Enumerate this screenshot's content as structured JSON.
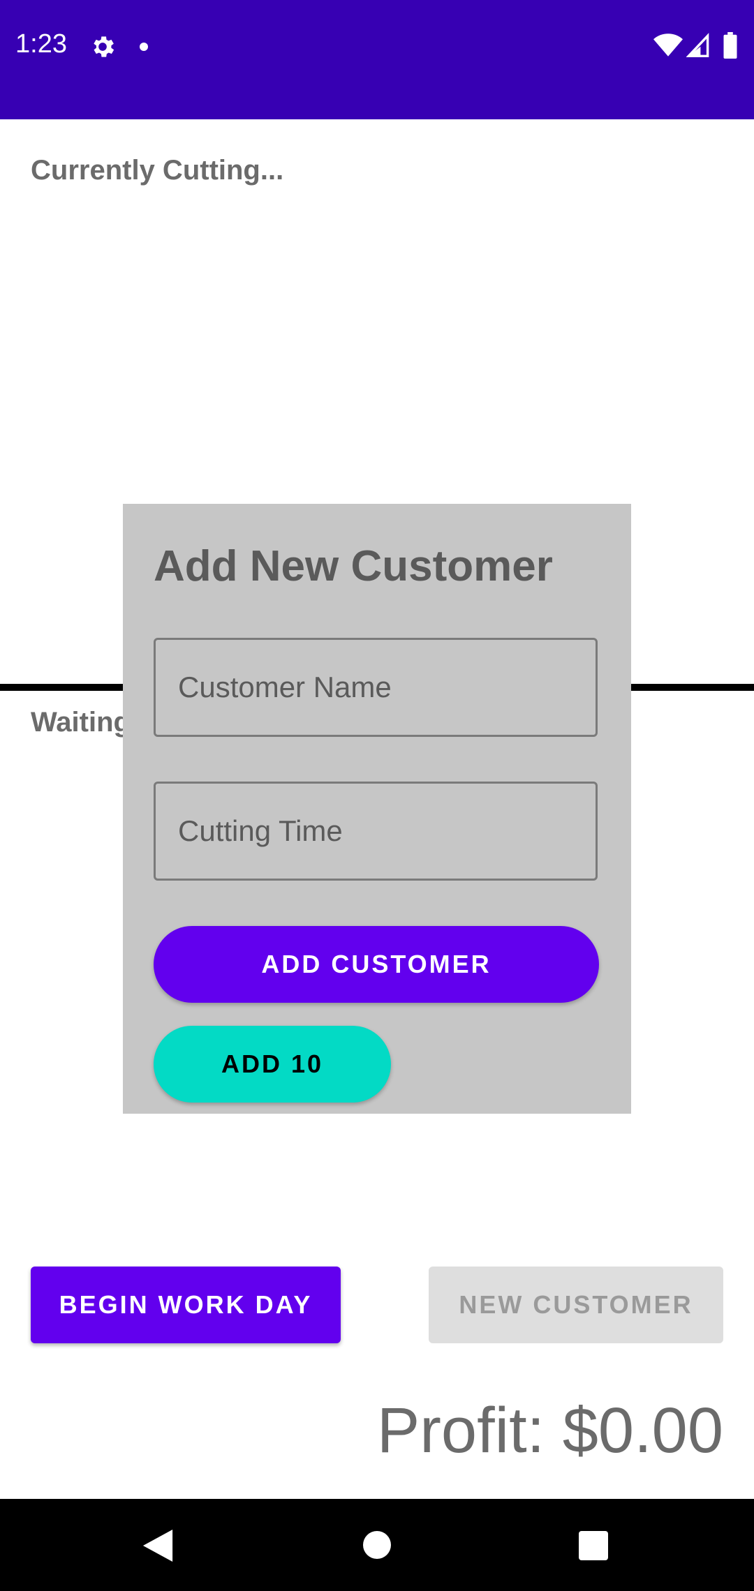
{
  "status_bar": {
    "time": "1:23",
    "background": "#3700b3",
    "icons": [
      "gear-icon",
      "notification-dot-icon",
      "wifi-icon",
      "cell-signal-icon",
      "battery-icon"
    ]
  },
  "main": {
    "currently_cutting_label": "Currently Cutting...",
    "waiting_label": "Waiting"
  },
  "dialog": {
    "title": "Add New Customer",
    "customer_name_placeholder": "Customer Name",
    "cutting_time_placeholder": "Cutting Time",
    "add_customer_label": "ADD CUSTOMER",
    "add10_label": "ADD 10",
    "background": "#c6c6c6"
  },
  "actions": {
    "begin_work_day_label": "BEGIN WORK DAY",
    "new_customer_label": "NEW CUSTOMER",
    "new_customer_enabled": false
  },
  "profit": {
    "text": "Profit: $0.00"
  },
  "colors": {
    "primary": "#6200ee",
    "secondary": "#03dac5",
    "primary_dark": "#3700b3"
  },
  "nav_bar": {
    "icons": [
      "back-icon",
      "home-icon",
      "recents-icon"
    ]
  }
}
